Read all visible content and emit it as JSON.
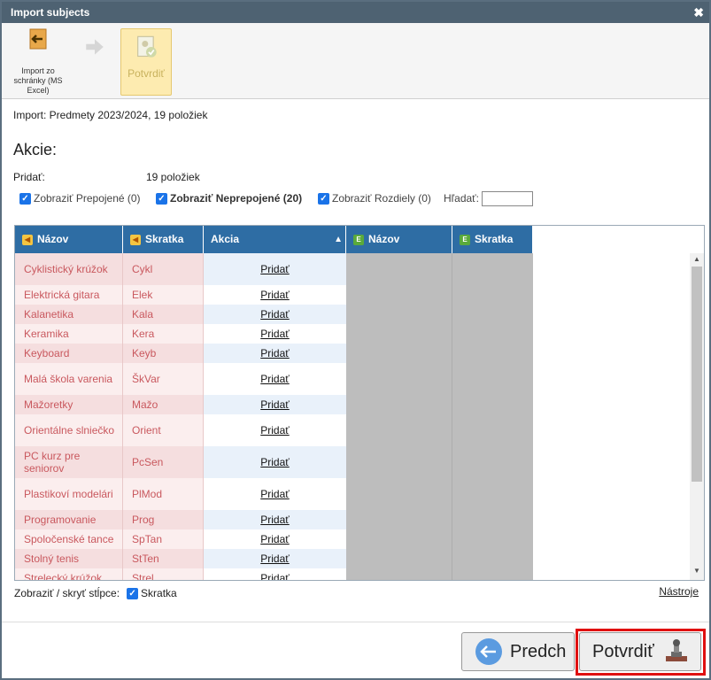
{
  "window": {
    "title": "Import subjects",
    "close_symbol": "✖"
  },
  "toolbar": {
    "import_label": "Import zo schránky (MS Excel)",
    "confirm_label": "Potvrdiť"
  },
  "info": "Import: Predmety 2023/2024, 19 položiek",
  "section_title": "Akcie:",
  "add_label": "Pridať:",
  "add_count": "19 položiek",
  "filters": {
    "show_linked": "Zobraziť Prepojené (0)",
    "show_unlinked": "Zobraziť Neprepojené (20)",
    "show_diff": "Zobraziť Rozdiely (0)",
    "search_label": "Hľadať:",
    "search_value": ""
  },
  "columns": {
    "name": "Názov",
    "short": "Skratka",
    "action": "Akcia",
    "name2": "Názov",
    "short2": "Skratka",
    "sort_symbol": "▲"
  },
  "rows": [
    {
      "name": "Cyklistický krúžok",
      "short": "Cykl",
      "action": "Pridať"
    },
    {
      "name": "Elektrická gitara",
      "short": "Elek",
      "action": "Pridať"
    },
    {
      "name": "Kalanetika",
      "short": "Kala",
      "action": "Pridať"
    },
    {
      "name": "Keramika",
      "short": "Kera",
      "action": "Pridať"
    },
    {
      "name": "Keyboard",
      "short": "Keyb",
      "action": "Pridať"
    },
    {
      "name": "Malá škola varenia",
      "short": "ŠkVar",
      "action": "Pridať"
    },
    {
      "name": "Mažoretky",
      "short": "Mažo",
      "action": "Pridať"
    },
    {
      "name": "Orientálne slniečko",
      "short": "Orient",
      "action": "Pridať"
    },
    {
      "name": "PC kurz pre seniorov",
      "short": "PcSen",
      "action": "Pridať"
    },
    {
      "name": "Plastikoví modelári",
      "short": "PlMod",
      "action": "Pridať"
    },
    {
      "name": "Programovanie",
      "short": "Prog",
      "action": "Pridať"
    },
    {
      "name": "Spoločenské tance",
      "short": "SpTan",
      "action": "Pridať"
    },
    {
      "name": "Stolný tenis",
      "short": "StTen",
      "action": "Pridať"
    },
    {
      "name": "Strelecký krúžok",
      "short": "Strel",
      "action": "Pridať"
    }
  ],
  "footer": {
    "toggle_label": "Zobraziť / skryť stĺpce:",
    "toggle_short": "Skratka",
    "tools": "Nástroje"
  },
  "buttons": {
    "prev": "Predch",
    "confirm": "Potvrdiť"
  },
  "colors": {
    "title_bg": "#4e6272",
    "header_bg": "#2e6da4",
    "unmatched_text": "#c9585e",
    "highlight": "#e01010"
  }
}
